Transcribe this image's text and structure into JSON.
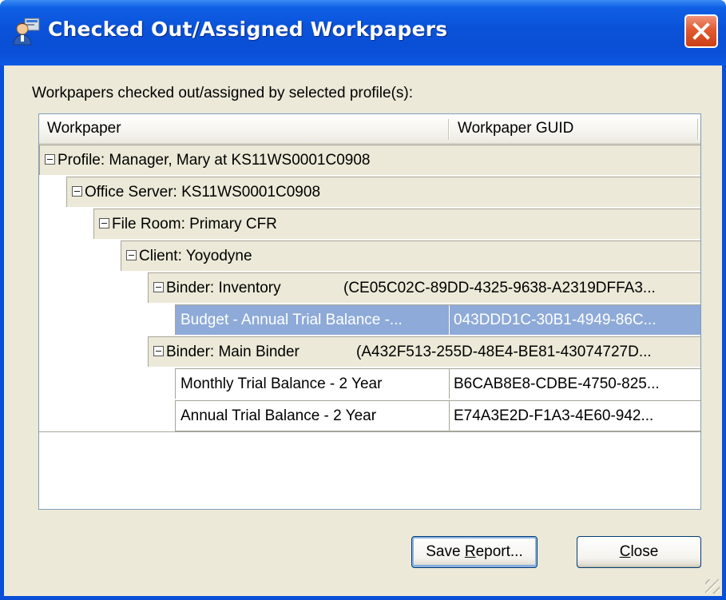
{
  "window": {
    "title": "Checked Out/Assigned Workpapers",
    "icon": "profile-workpaper-icon",
    "accent_color": "#0a4fd6",
    "close_color": "#e05a30"
  },
  "prompt": "Workpapers checked out/assigned by selected profile(s):",
  "tree": {
    "columns": [
      "Workpaper",
      "Workpaper GUID"
    ],
    "nodes": [
      {
        "label": "Profile: Manager, Mary at KS11WS0001C0908",
        "guid": ""
      },
      {
        "label": "Office Server: KS11WS0001C0908",
        "guid": ""
      },
      {
        "label": "File Room: Primary CFR",
        "guid": ""
      },
      {
        "label": "Client: Yoyodyne",
        "guid": ""
      },
      {
        "label": "Binder:  Inventory",
        "guid": "(CE05C02C-89DD-4325-9638-A2319DFFA3..."
      },
      {
        "label": "Budget - Annual Trial Balance -...",
        "guid": "043DDD1C-30B1-4949-86C..."
      },
      {
        "label": "Binder:  Main Binder",
        "guid": "(A432F513-255D-48E4-BE81-43074727D..."
      },
      {
        "label": "Monthly Trial Balance - 2 Year",
        "guid": "B6CAB8E8-CDBE-4750-825..."
      },
      {
        "label": "Annual Trial Balance - 2 Year",
        "guid": "E74A3E2D-F1A3-4E60-942..."
      }
    ],
    "selected_color": "#8eaad8"
  },
  "buttons": {
    "save_pre": "Save ",
    "save_u": "R",
    "save_post": "eport...",
    "close_u": "C",
    "close_post": "lose"
  }
}
